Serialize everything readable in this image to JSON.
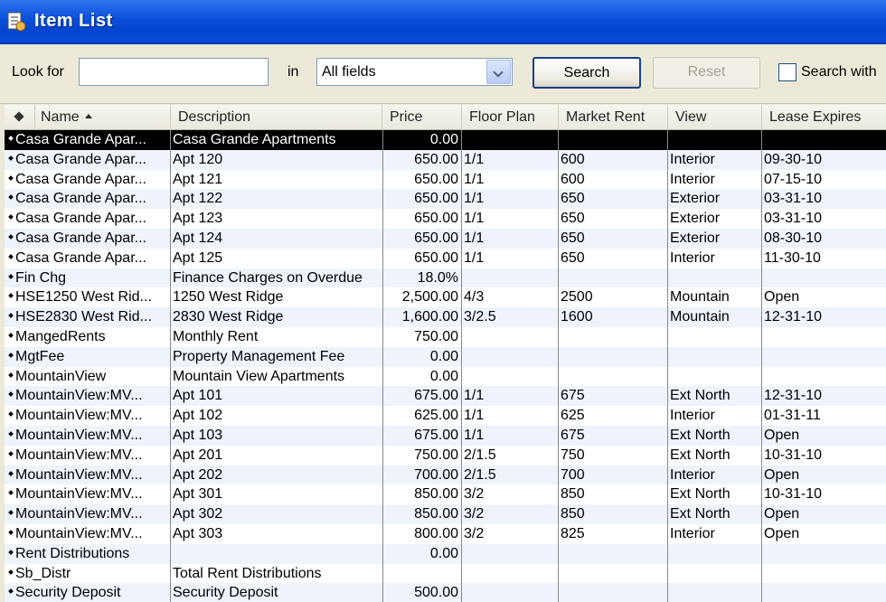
{
  "window": {
    "title": "Item List"
  },
  "toolbar": {
    "look_for_label": "Look for",
    "search_value": "",
    "in_label": "in",
    "field_select_value": "All fields",
    "search_button": "Search",
    "reset_button": "Reset",
    "search_within_label": "Search with"
  },
  "table": {
    "columns": [
      "Name",
      "Description",
      "Price",
      "Floor Plan",
      "Market Rent",
      "View",
      "Lease Expires"
    ],
    "rows": [
      {
        "name": "Casa Grande Apar...",
        "description": "Casa Grande Apartments",
        "price": "0.00",
        "floor_plan": "",
        "market_rent": "",
        "view": "",
        "lease_expires": ""
      },
      {
        "name": "Casa Grande Apar...",
        "description": "Apt 120",
        "price": "650.00",
        "floor_plan": "1/1",
        "market_rent": "600",
        "view": "Interior",
        "lease_expires": "09-30-10"
      },
      {
        "name": "Casa Grande Apar...",
        "description": "Apt 121",
        "price": "650.00",
        "floor_plan": "1/1",
        "market_rent": "600",
        "view": "Interior",
        "lease_expires": "07-15-10"
      },
      {
        "name": "Casa Grande Apar...",
        "description": "Apt 122",
        "price": "650.00",
        "floor_plan": "1/1",
        "market_rent": "650",
        "view": "Exterior",
        "lease_expires": "03-31-10"
      },
      {
        "name": "Casa Grande Apar...",
        "description": "Apt 123",
        "price": "650.00",
        "floor_plan": "1/1",
        "market_rent": "650",
        "view": "Exterior",
        "lease_expires": "03-31-10"
      },
      {
        "name": "Casa Grande Apar...",
        "description": "Apt 124",
        "price": "650.00",
        "floor_plan": "1/1",
        "market_rent": "650",
        "view": "Exterior",
        "lease_expires": "08-30-10"
      },
      {
        "name": "Casa Grande Apar...",
        "description": "Apt 125",
        "price": "650.00",
        "floor_plan": "1/1",
        "market_rent": "650",
        "view": "Interior",
        "lease_expires": "11-30-10"
      },
      {
        "name": "Fin Chg",
        "description": "Finance Charges on Overdue",
        "price": "18.0%",
        "floor_plan": "",
        "market_rent": "",
        "view": "",
        "lease_expires": ""
      },
      {
        "name": "HSE1250 West Rid...",
        "description": "1250 West Ridge",
        "price": "2,500.00",
        "floor_plan": "4/3",
        "market_rent": "2500",
        "view": "Mountain",
        "lease_expires": "Open"
      },
      {
        "name": "HSE2830 West Rid...",
        "description": "2830 West Ridge",
        "price": "1,600.00",
        "floor_plan": "3/2.5",
        "market_rent": "1600",
        "view": "Mountain",
        "lease_expires": "12-31-10"
      },
      {
        "name": "MangedRents",
        "description": "Monthly Rent",
        "price": "750.00",
        "floor_plan": "",
        "market_rent": "",
        "view": "",
        "lease_expires": ""
      },
      {
        "name": "MgtFee",
        "description": "Property Management Fee",
        "price": "0.00",
        "floor_plan": "",
        "market_rent": "",
        "view": "",
        "lease_expires": ""
      },
      {
        "name": "MountainView",
        "description": "Mountain View Apartments",
        "price": "0.00",
        "floor_plan": "",
        "market_rent": "",
        "view": "",
        "lease_expires": ""
      },
      {
        "name": "MountainView:MV...",
        "description": "Apt 101",
        "price": "675.00",
        "floor_plan": "1/1",
        "market_rent": "675",
        "view": "Ext North",
        "lease_expires": "12-31-10"
      },
      {
        "name": "MountainView:MV...",
        "description": "Apt 102",
        "price": "625.00",
        "floor_plan": "1/1",
        "market_rent": "625",
        "view": "Interior",
        "lease_expires": "01-31-11"
      },
      {
        "name": "MountainView:MV...",
        "description": "Apt 103",
        "price": "675.00",
        "floor_plan": "1/1",
        "market_rent": "675",
        "view": "Ext North",
        "lease_expires": "Open"
      },
      {
        "name": "MountainView:MV...",
        "description": "Apt 201",
        "price": "750.00",
        "floor_plan": "2/1.5",
        "market_rent": "750",
        "view": "Ext North",
        "lease_expires": "10-31-10"
      },
      {
        "name": "MountainView:MV...",
        "description": "Apt 202",
        "price": "700.00",
        "floor_plan": "2/1.5",
        "market_rent": "700",
        "view": "Interior",
        "lease_expires": "Open"
      },
      {
        "name": "MountainView:MV...",
        "description": "Apt 301",
        "price": "850.00",
        "floor_plan": "3/2",
        "market_rent": "850",
        "view": "Ext North",
        "lease_expires": "10-31-10"
      },
      {
        "name": "MountainView:MV...",
        "description": "Apt 302",
        "price": "850.00",
        "floor_plan": "3/2",
        "market_rent": "850",
        "view": "Ext North",
        "lease_expires": "Open"
      },
      {
        "name": "MountainView:MV...",
        "description": "Apt 303",
        "price": "800.00",
        "floor_plan": "3/2",
        "market_rent": "825",
        "view": "Interior",
        "lease_expires": "Open"
      },
      {
        "name": "Rent Distributions",
        "description": "",
        "price": "0.00",
        "floor_plan": "",
        "market_rent": "",
        "view": "",
        "lease_expires": ""
      },
      {
        "name": "Sb_Distr",
        "description": "Total Rent Distributions",
        "price": "",
        "floor_plan": "",
        "market_rent": "",
        "view": "",
        "lease_expires": ""
      },
      {
        "name": "Security Deposit",
        "description": "Security Deposit",
        "price": "500.00",
        "floor_plan": "",
        "market_rent": "",
        "view": "",
        "lease_expires": ""
      }
    ]
  },
  "colors": {
    "titlebar": "#0a4fd8",
    "selected_row": "#000000",
    "alt_row": "#eef3fc"
  },
  "icons": {
    "window": "item-list-icon",
    "sort": "sort-ascending-icon",
    "row_marker": "diamond-bullet-icon",
    "dropdown": "chevron-down-icon"
  }
}
